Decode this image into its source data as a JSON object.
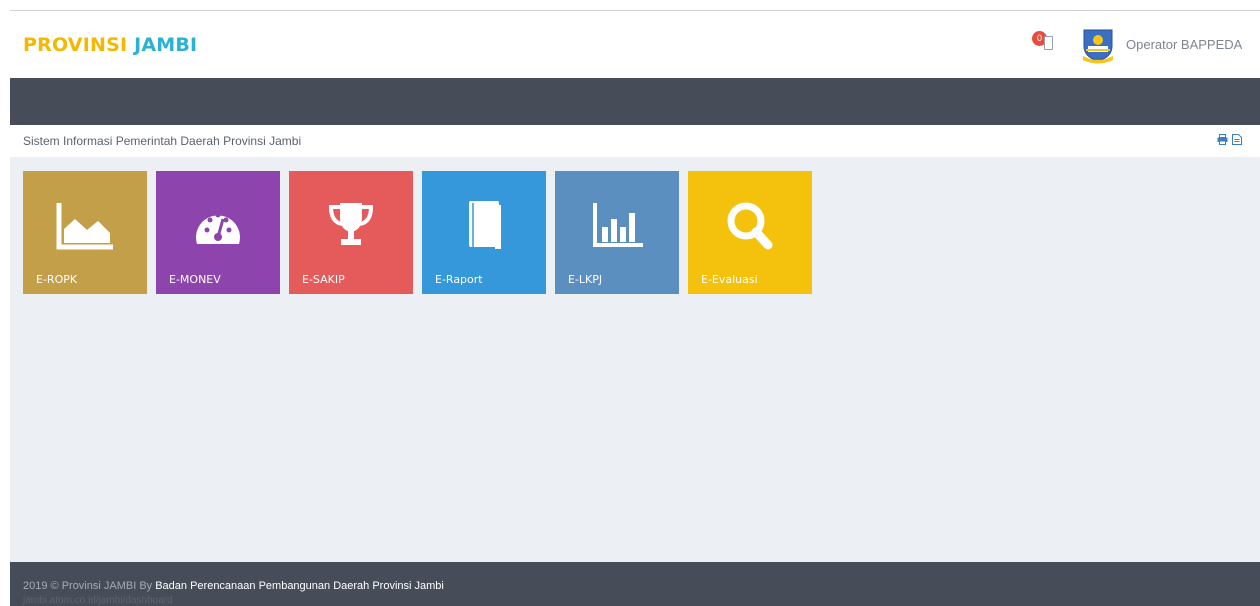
{
  "header": {
    "brand_part1": "PROVINSI",
    "brand_part2": "JAMBI",
    "notification_count": "0",
    "user_name": "Operator BAPPEDA"
  },
  "breadcrumb": {
    "text": "Sistem Informasi Pemerintah Daerah Provinsi Jambi",
    "print_icon": "print-icon",
    "pdf_icon": "pdf-icon"
  },
  "tiles": [
    {
      "label": "E-ROPK",
      "icon": "area-chart-icon",
      "color": "#c49f4a"
    },
    {
      "label": "E-MONEV",
      "icon": "dashboard-gauge-icon",
      "color": "#8e44ad"
    },
    {
      "label": "E-SAKIP",
      "icon": "trophy-icon",
      "color": "#e55b5b"
    },
    {
      "label": "E-Raport",
      "icon": "book-icon",
      "color": "#3498db"
    },
    {
      "label": "E-LKPJ",
      "icon": "bar-chart-icon",
      "color": "#5b8fc0"
    },
    {
      "label": "E-Evaluasi",
      "icon": "search-icon",
      "color": "#f4c20d"
    }
  ],
  "footer": {
    "copyright": "2019 © Provinsi JAMBI By",
    "organization": "Badan Perencanaan Pembangunan Daerah Provinsi Jambi",
    "url": "jambi.atom.co.id/jambi/dashboard"
  },
  "colors": {
    "navbar": "#464c58",
    "content_bg": "#eceff4",
    "brand_yellow": "#f5b800",
    "brand_teal": "#2bb1d4"
  }
}
